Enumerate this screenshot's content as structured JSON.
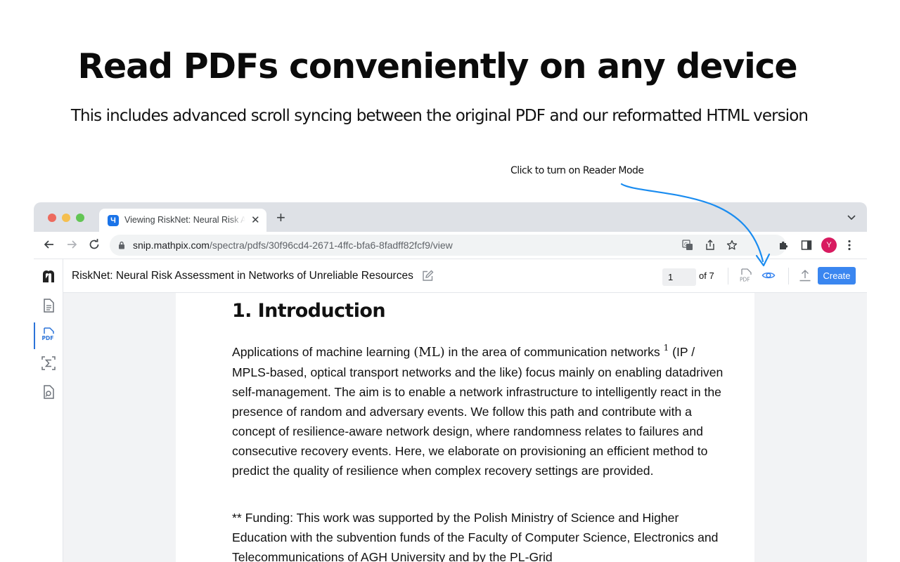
{
  "hero": {
    "title": "Read PDFs conveniently on any device",
    "subtitle": "This includes advanced scroll syncing between the original PDF and our reformatted HTML version",
    "callout": "Click to turn on Reader Mode"
  },
  "browser": {
    "tab_title": "Viewing RiskNet: Neural Risk Assessment in Networks of Unreliable Resources",
    "tab_favicon": "Ч",
    "url_host": "snip.mathpix.com",
    "url_path": "/spectra/pdfs/30f96cd4-2671-4ffc-bfa6-8fadff82fcf9/view",
    "avatar_letter": "Y"
  },
  "app": {
    "doc_title": "RiskNet: Neural Risk Assessment in Networks of Unreliable Resources",
    "page_current": "1",
    "page_total": "of 7",
    "create_label": "Create",
    "pdf_toggle_label": "PDF"
  },
  "content": {
    "heading": "1. Introduction",
    "p1_before": "Applications of machine learning ",
    "p1_math": "(ML)",
    "p1_middle": " in the area of communication networks ",
    "p1_footnote": "1",
    "p1_after": " (IP / MPLS-based, optical transport networks and the like) focus mainly on enabling datadriven self-management. The aim is to enable a network infrastructure to intelligently react in the presence of random and adversary events. We follow this path and contribute with a concept of resilience-aware network design, where randomness relates to failures and consecutive recovery events. Here, we elaborate on provisioning an efficient method to predict the quality of resilience when complex recovery settings are provided.",
    "p2": "** Funding: This work was supported by the Polish Ministry of Science and Higher Education with the subvention funds of the Faculty of Computer Science, Electronics and Telecommunications of AGH University and by the PL-Grid"
  },
  "icons": {
    "back": "arrow-left-icon",
    "forward": "arrow-right-icon",
    "reload": "reload-icon",
    "lock": "lock-icon",
    "translate": "translate-icon",
    "share": "share-icon",
    "bookmark": "star-icon",
    "extensions": "puzzle-icon",
    "sidepanel": "side-panel-icon",
    "menu": "kebab-menu-icon",
    "reader_mode": "eye-icon"
  },
  "colors": {
    "accent": "#3a86f0",
    "arrow": "#1a8cf0",
    "avatar": "#d81b60"
  }
}
